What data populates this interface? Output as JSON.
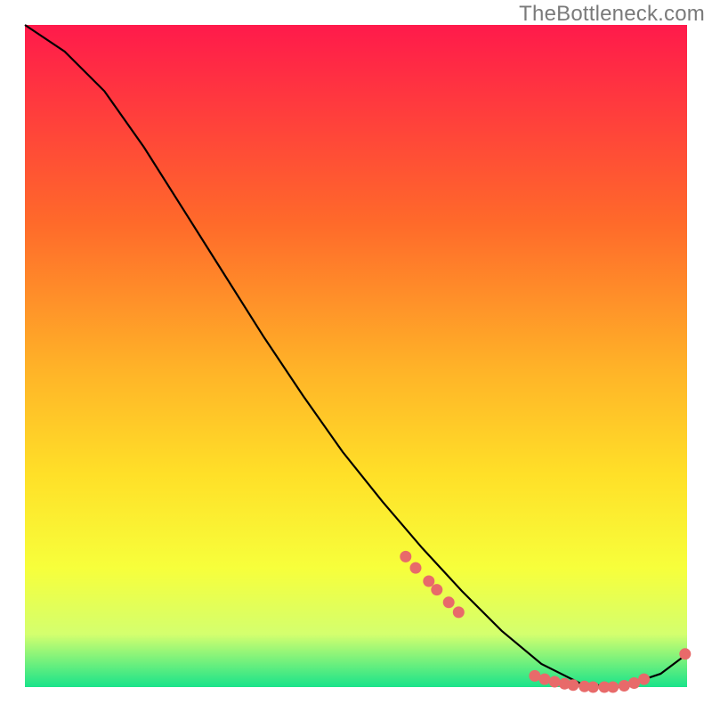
{
  "watermark": "TheBottleneck.com",
  "colors": {
    "top": "#ff1a4b",
    "mid1": "#ff6a2a",
    "mid2": "#ffb328",
    "mid3": "#ffe028",
    "mid4": "#f7ff3b",
    "band": "#d4ff6e",
    "green": "#19e38a",
    "black": "#000000",
    "marker": "#e86a6a"
  },
  "chart_data": {
    "type": "line",
    "x": [
      0.0,
      0.06,
      0.12,
      0.18,
      0.24,
      0.3,
      0.36,
      0.42,
      0.48,
      0.54,
      0.6,
      0.66,
      0.72,
      0.78,
      0.84,
      0.9,
      0.96,
      1.0
    ],
    "values": [
      1.0,
      0.96,
      0.9,
      0.815,
      0.72,
      0.625,
      0.53,
      0.44,
      0.355,
      0.28,
      0.21,
      0.145,
      0.085,
      0.035,
      0.005,
      0.0,
      0.02,
      0.05
    ],
    "title": "",
    "xlabel": "",
    "ylabel": "",
    "ylim": [
      0,
      1
    ],
    "xlim": [
      0,
      1
    ],
    "markers": [
      {
        "x": 0.575,
        "y": 0.197
      },
      {
        "x": 0.59,
        "y": 0.18
      },
      {
        "x": 0.61,
        "y": 0.16
      },
      {
        "x": 0.622,
        "y": 0.147
      },
      {
        "x": 0.64,
        "y": 0.128
      },
      {
        "x": 0.655,
        "y": 0.113
      },
      {
        "x": 0.77,
        "y": 0.017
      },
      {
        "x": 0.785,
        "y": 0.012
      },
      {
        "x": 0.8,
        "y": 0.008
      },
      {
        "x": 0.815,
        "y": 0.005
      },
      {
        "x": 0.828,
        "y": 0.003
      },
      {
        "x": 0.845,
        "y": 0.001
      },
      {
        "x": 0.858,
        "y": 0.0
      },
      {
        "x": 0.875,
        "y": 0.0
      },
      {
        "x": 0.888,
        "y": 0.0
      },
      {
        "x": 0.905,
        "y": 0.002
      },
      {
        "x": 0.92,
        "y": 0.006
      },
      {
        "x": 0.935,
        "y": 0.012
      },
      {
        "x": 0.997,
        "y": 0.05
      }
    ]
  }
}
